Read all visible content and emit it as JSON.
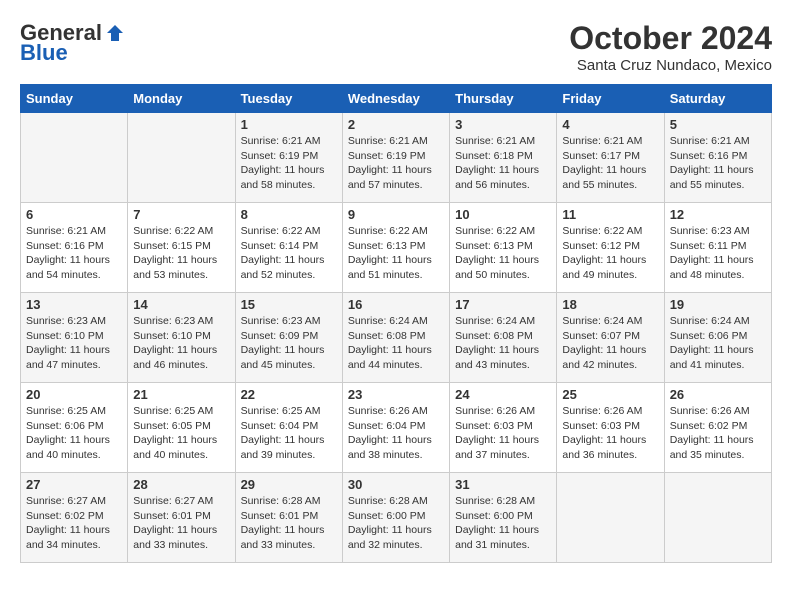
{
  "header": {
    "logo_general": "General",
    "logo_blue": "Blue",
    "month": "October 2024",
    "location": "Santa Cruz Nundaco, Mexico"
  },
  "weekdays": [
    "Sunday",
    "Monday",
    "Tuesday",
    "Wednesday",
    "Thursday",
    "Friday",
    "Saturday"
  ],
  "weeks": [
    [
      {
        "day": "",
        "sunrise": "",
        "sunset": "",
        "daylight": ""
      },
      {
        "day": "",
        "sunrise": "",
        "sunset": "",
        "daylight": ""
      },
      {
        "day": "1",
        "sunrise": "Sunrise: 6:21 AM",
        "sunset": "Sunset: 6:19 PM",
        "daylight": "Daylight: 11 hours and 58 minutes."
      },
      {
        "day": "2",
        "sunrise": "Sunrise: 6:21 AM",
        "sunset": "Sunset: 6:19 PM",
        "daylight": "Daylight: 11 hours and 57 minutes."
      },
      {
        "day": "3",
        "sunrise": "Sunrise: 6:21 AM",
        "sunset": "Sunset: 6:18 PM",
        "daylight": "Daylight: 11 hours and 56 minutes."
      },
      {
        "day": "4",
        "sunrise": "Sunrise: 6:21 AM",
        "sunset": "Sunset: 6:17 PM",
        "daylight": "Daylight: 11 hours and 55 minutes."
      },
      {
        "day": "5",
        "sunrise": "Sunrise: 6:21 AM",
        "sunset": "Sunset: 6:16 PM",
        "daylight": "Daylight: 11 hours and 55 minutes."
      }
    ],
    [
      {
        "day": "6",
        "sunrise": "Sunrise: 6:21 AM",
        "sunset": "Sunset: 6:16 PM",
        "daylight": "Daylight: 11 hours and 54 minutes."
      },
      {
        "day": "7",
        "sunrise": "Sunrise: 6:22 AM",
        "sunset": "Sunset: 6:15 PM",
        "daylight": "Daylight: 11 hours and 53 minutes."
      },
      {
        "day": "8",
        "sunrise": "Sunrise: 6:22 AM",
        "sunset": "Sunset: 6:14 PM",
        "daylight": "Daylight: 11 hours and 52 minutes."
      },
      {
        "day": "9",
        "sunrise": "Sunrise: 6:22 AM",
        "sunset": "Sunset: 6:13 PM",
        "daylight": "Daylight: 11 hours and 51 minutes."
      },
      {
        "day": "10",
        "sunrise": "Sunrise: 6:22 AM",
        "sunset": "Sunset: 6:13 PM",
        "daylight": "Daylight: 11 hours and 50 minutes."
      },
      {
        "day": "11",
        "sunrise": "Sunrise: 6:22 AM",
        "sunset": "Sunset: 6:12 PM",
        "daylight": "Daylight: 11 hours and 49 minutes."
      },
      {
        "day": "12",
        "sunrise": "Sunrise: 6:23 AM",
        "sunset": "Sunset: 6:11 PM",
        "daylight": "Daylight: 11 hours and 48 minutes."
      }
    ],
    [
      {
        "day": "13",
        "sunrise": "Sunrise: 6:23 AM",
        "sunset": "Sunset: 6:10 PM",
        "daylight": "Daylight: 11 hours and 47 minutes."
      },
      {
        "day": "14",
        "sunrise": "Sunrise: 6:23 AM",
        "sunset": "Sunset: 6:10 PM",
        "daylight": "Daylight: 11 hours and 46 minutes."
      },
      {
        "day": "15",
        "sunrise": "Sunrise: 6:23 AM",
        "sunset": "Sunset: 6:09 PM",
        "daylight": "Daylight: 11 hours and 45 minutes."
      },
      {
        "day": "16",
        "sunrise": "Sunrise: 6:24 AM",
        "sunset": "Sunset: 6:08 PM",
        "daylight": "Daylight: 11 hours and 44 minutes."
      },
      {
        "day": "17",
        "sunrise": "Sunrise: 6:24 AM",
        "sunset": "Sunset: 6:08 PM",
        "daylight": "Daylight: 11 hours and 43 minutes."
      },
      {
        "day": "18",
        "sunrise": "Sunrise: 6:24 AM",
        "sunset": "Sunset: 6:07 PM",
        "daylight": "Daylight: 11 hours and 42 minutes."
      },
      {
        "day": "19",
        "sunrise": "Sunrise: 6:24 AM",
        "sunset": "Sunset: 6:06 PM",
        "daylight": "Daylight: 11 hours and 41 minutes."
      }
    ],
    [
      {
        "day": "20",
        "sunrise": "Sunrise: 6:25 AM",
        "sunset": "Sunset: 6:06 PM",
        "daylight": "Daylight: 11 hours and 40 minutes."
      },
      {
        "day": "21",
        "sunrise": "Sunrise: 6:25 AM",
        "sunset": "Sunset: 6:05 PM",
        "daylight": "Daylight: 11 hours and 40 minutes."
      },
      {
        "day": "22",
        "sunrise": "Sunrise: 6:25 AM",
        "sunset": "Sunset: 6:04 PM",
        "daylight": "Daylight: 11 hours and 39 minutes."
      },
      {
        "day": "23",
        "sunrise": "Sunrise: 6:26 AM",
        "sunset": "Sunset: 6:04 PM",
        "daylight": "Daylight: 11 hours and 38 minutes."
      },
      {
        "day": "24",
        "sunrise": "Sunrise: 6:26 AM",
        "sunset": "Sunset: 6:03 PM",
        "daylight": "Daylight: 11 hours and 37 minutes."
      },
      {
        "day": "25",
        "sunrise": "Sunrise: 6:26 AM",
        "sunset": "Sunset: 6:03 PM",
        "daylight": "Daylight: 11 hours and 36 minutes."
      },
      {
        "day": "26",
        "sunrise": "Sunrise: 6:26 AM",
        "sunset": "Sunset: 6:02 PM",
        "daylight": "Daylight: 11 hours and 35 minutes."
      }
    ],
    [
      {
        "day": "27",
        "sunrise": "Sunrise: 6:27 AM",
        "sunset": "Sunset: 6:02 PM",
        "daylight": "Daylight: 11 hours and 34 minutes."
      },
      {
        "day": "28",
        "sunrise": "Sunrise: 6:27 AM",
        "sunset": "Sunset: 6:01 PM",
        "daylight": "Daylight: 11 hours and 33 minutes."
      },
      {
        "day": "29",
        "sunrise": "Sunrise: 6:28 AM",
        "sunset": "Sunset: 6:01 PM",
        "daylight": "Daylight: 11 hours and 33 minutes."
      },
      {
        "day": "30",
        "sunrise": "Sunrise: 6:28 AM",
        "sunset": "Sunset: 6:00 PM",
        "daylight": "Daylight: 11 hours and 32 minutes."
      },
      {
        "day": "31",
        "sunrise": "Sunrise: 6:28 AM",
        "sunset": "Sunset: 6:00 PM",
        "daylight": "Daylight: 11 hours and 31 minutes."
      },
      {
        "day": "",
        "sunrise": "",
        "sunset": "",
        "daylight": ""
      },
      {
        "day": "",
        "sunrise": "",
        "sunset": "",
        "daylight": ""
      }
    ]
  ]
}
